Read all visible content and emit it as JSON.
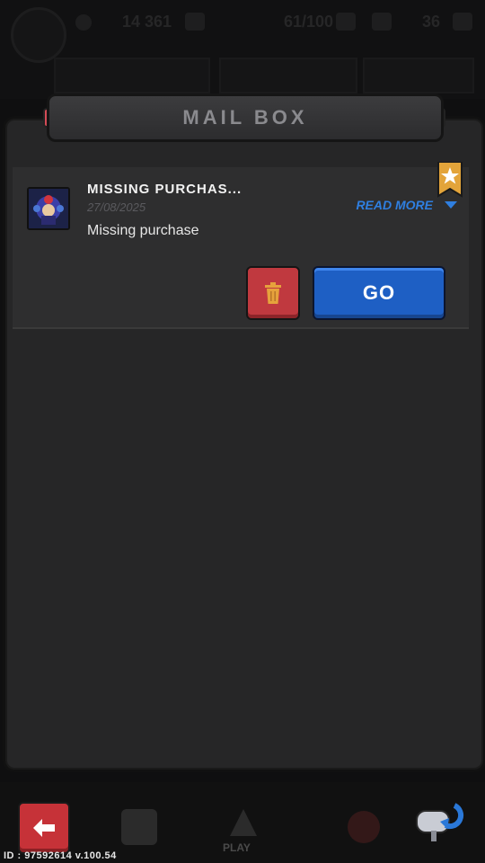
{
  "hud": {
    "gold": "14 361",
    "energy": "61/100",
    "tickets": "36"
  },
  "header": {
    "title": "MAIL BOX"
  },
  "mails": [
    {
      "title": "MISSING PURCHAS...",
      "date": "27/08/2025",
      "body": "Missing purchase",
      "read_more": "READ MORE",
      "go_label": "GO"
    }
  ],
  "bottom_nav": {
    "play_label": "PLAY"
  },
  "build_id": "ID : 97592614  v.100.54",
  "colors": {
    "go": "#1e5fc4",
    "delete": "#c0393f",
    "back": "#c63238",
    "accent_read_more": "#2f7fe0"
  }
}
